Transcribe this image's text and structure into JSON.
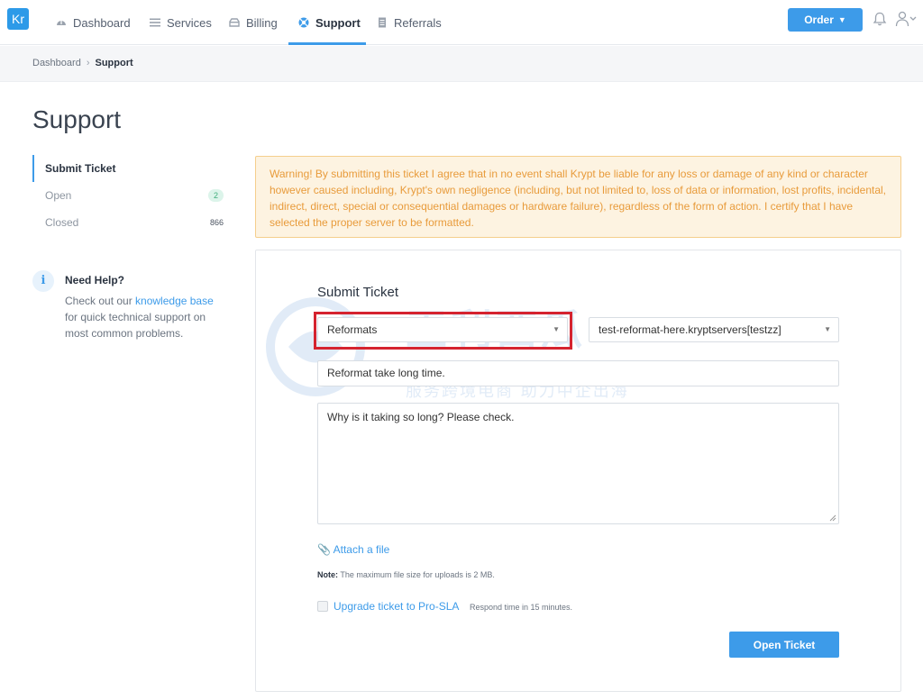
{
  "brand": {
    "logo_text": "Kr",
    "accent": "#3d9be9",
    "warning_color": "#e89b3b",
    "highlight_color": "#d5232f"
  },
  "nav": {
    "items": [
      {
        "label": "Dashboard",
        "icon": "dashboard-icon"
      },
      {
        "label": "Services",
        "icon": "list-icon"
      },
      {
        "label": "Billing",
        "icon": "billing-icon"
      },
      {
        "label": "Support",
        "icon": "lifebuoy-icon",
        "active": true
      },
      {
        "label": "Referrals",
        "icon": "document-icon"
      }
    ],
    "order_label": "Order"
  },
  "breadcrumb": {
    "root": "Dashboard",
    "current": "Support"
  },
  "page_title": "Support",
  "sidebar": {
    "items": [
      {
        "label": "Submit Ticket",
        "active": true
      },
      {
        "label": "Open",
        "count": "2"
      },
      {
        "label": "Closed",
        "count": "866"
      }
    ]
  },
  "help": {
    "title": "Need Help?",
    "text_before": "Check out our ",
    "link": "knowledge base",
    "text_after": " for quick technical support on most common problems."
  },
  "warning": "Warning! By submitting this ticket I agree that in no event shall Krypt be liable for any loss or damage of any kind or character however caused including, Krypt's own negligence (including, but not limited to, loss of data or information, lost profits, incidental, indirect, direct, special or consequential damages or hardware failure), regardless of the form of action. I certify that I have selected the proper server to be formatted.",
  "form": {
    "title": "Submit Ticket",
    "department": "Reformats",
    "server": "test-reformat-here.kryptservers[testzz]",
    "subject": "Reformat take long time.",
    "message": "Why is it taking so long? Please check.",
    "attach_label": "Attach a file",
    "note_label": "Note:",
    "note_text": "The maximum file size for uploads is 2 MB.",
    "upgrade_label": "Upgrade ticket to Pro-SLA",
    "upgrade_note": "Respond time in 15 minutes.",
    "submit_label": "Open Ticket"
  },
  "watermark": {
    "title": "王利西瓜",
    "subtitle": "服务跨境电商 助力中企出海"
  }
}
